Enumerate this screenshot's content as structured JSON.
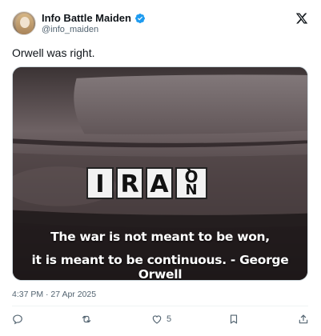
{
  "author": {
    "display_name": "Info Battle Maiden",
    "handle": "@info_maiden",
    "verified": true
  },
  "tweet": {
    "text": "Orwell was right.",
    "timestamp": "4:37 PM · 27 Apr 2025"
  },
  "media": {
    "plate_text": "IRAQ",
    "caption_line1": "The war is not meant to be won,",
    "caption_line2": "it is meant to be continuous.  - George Orwell"
  },
  "actions": {
    "reply_count": "",
    "retweet_count": "",
    "like_count": "5",
    "bookmark_count": ""
  },
  "icons": [
    "verified-badge-icon",
    "x-logo-icon",
    "reply-icon",
    "retweet-icon",
    "like-icon",
    "bookmark-icon",
    "share-icon"
  ],
  "colors": {
    "verified_blue": "#1d9bf0",
    "secondary_text": "#536471",
    "primary_text": "#0f1419"
  }
}
